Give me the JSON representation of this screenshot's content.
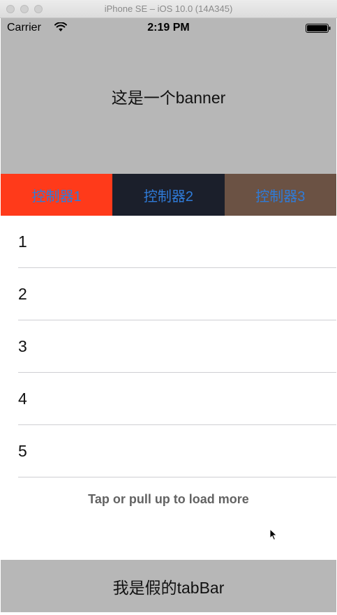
{
  "window": {
    "title": "iPhone SE – iOS 10.0 (14A345)"
  },
  "statusbar": {
    "carrier": "Carrier",
    "time": "2:19 PM",
    "wifi_icon": "wifi-icon",
    "battery_icon": "battery-icon"
  },
  "banner": {
    "text": "这是一个banner"
  },
  "tabs": [
    {
      "label": "控制器1",
      "background": "#ff3a1a",
      "text_color": "#2f7bd8"
    },
    {
      "label": "控制器2",
      "background": "#1b1f2b",
      "text_color": "#2f7bd8"
    },
    {
      "label": "控制器3",
      "background": "#6b5244",
      "text_color": "#2f7bd8"
    }
  ],
  "list": {
    "rows": [
      "1",
      "2",
      "3",
      "4",
      "5"
    ],
    "load_more": "Tap or pull up to load more"
  },
  "tabbar": {
    "label": "我是假的tabBar"
  }
}
